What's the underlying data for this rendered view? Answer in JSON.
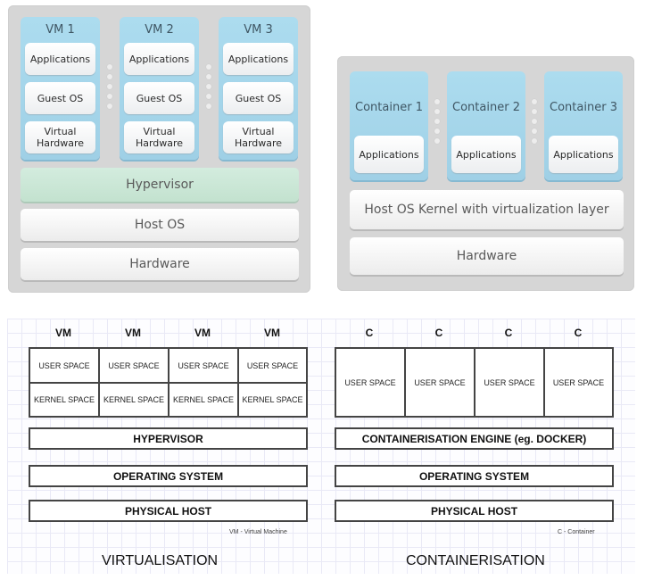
{
  "virtualization_glossy": {
    "vms": [
      {
        "title": "VM 1",
        "layers": [
          "Applications",
          "Guest OS",
          "Virtual\nHardware"
        ]
      },
      {
        "title": "VM 2",
        "layers": [
          "Applications",
          "Guest OS",
          "Virtual\nHardware"
        ]
      },
      {
        "title": "VM 3",
        "layers": [
          "Applications",
          "Guest OS",
          "Virtual\nHardware"
        ]
      }
    ],
    "stack": [
      "Hypervisor",
      "Host OS",
      "Hardware"
    ],
    "colors": {
      "vm_column": "#a8d9ee",
      "hypervisor": "#c8e6d4",
      "panel": "#d6d6d6"
    }
  },
  "containerization_glossy": {
    "containers": [
      {
        "title": "Container 1",
        "layers": [
          "Applications"
        ]
      },
      {
        "title": "Container 2",
        "layers": [
          "Applications"
        ]
      },
      {
        "title": "Container 3",
        "layers": [
          "Applications"
        ]
      }
    ],
    "stack": [
      "Host OS Kernel with virtualization layer",
      "Hardware"
    ]
  },
  "virtualisation_schematic": {
    "headers": [
      "VM",
      "VM",
      "VM",
      "VM"
    ],
    "user_space": [
      "USER SPACE",
      "USER SPACE",
      "USER SPACE",
      "USER SPACE"
    ],
    "kernel_space": [
      "KERNEL SPACE",
      "KERNEL SPACE",
      "KERNEL SPACE",
      "KERNEL SPACE"
    ],
    "layers": [
      "HYPERVISOR",
      "OPERATING SYSTEM",
      "PHYSICAL HOST"
    ],
    "legend": "VM - Virtual Machine",
    "caption": "VIRTUALISATION"
  },
  "containerisation_schematic": {
    "headers": [
      "C",
      "C",
      "C",
      "C"
    ],
    "user_space": [
      "USER SPACE",
      "USER SPACE",
      "USER SPACE",
      "USER SPACE"
    ],
    "layers": [
      "CONTAINERISATION ENGINE (eg. DOCKER)",
      "OPERATING SYSTEM",
      "PHYSICAL HOST"
    ],
    "legend": "C - Container",
    "caption": "CONTAINERISATION"
  }
}
